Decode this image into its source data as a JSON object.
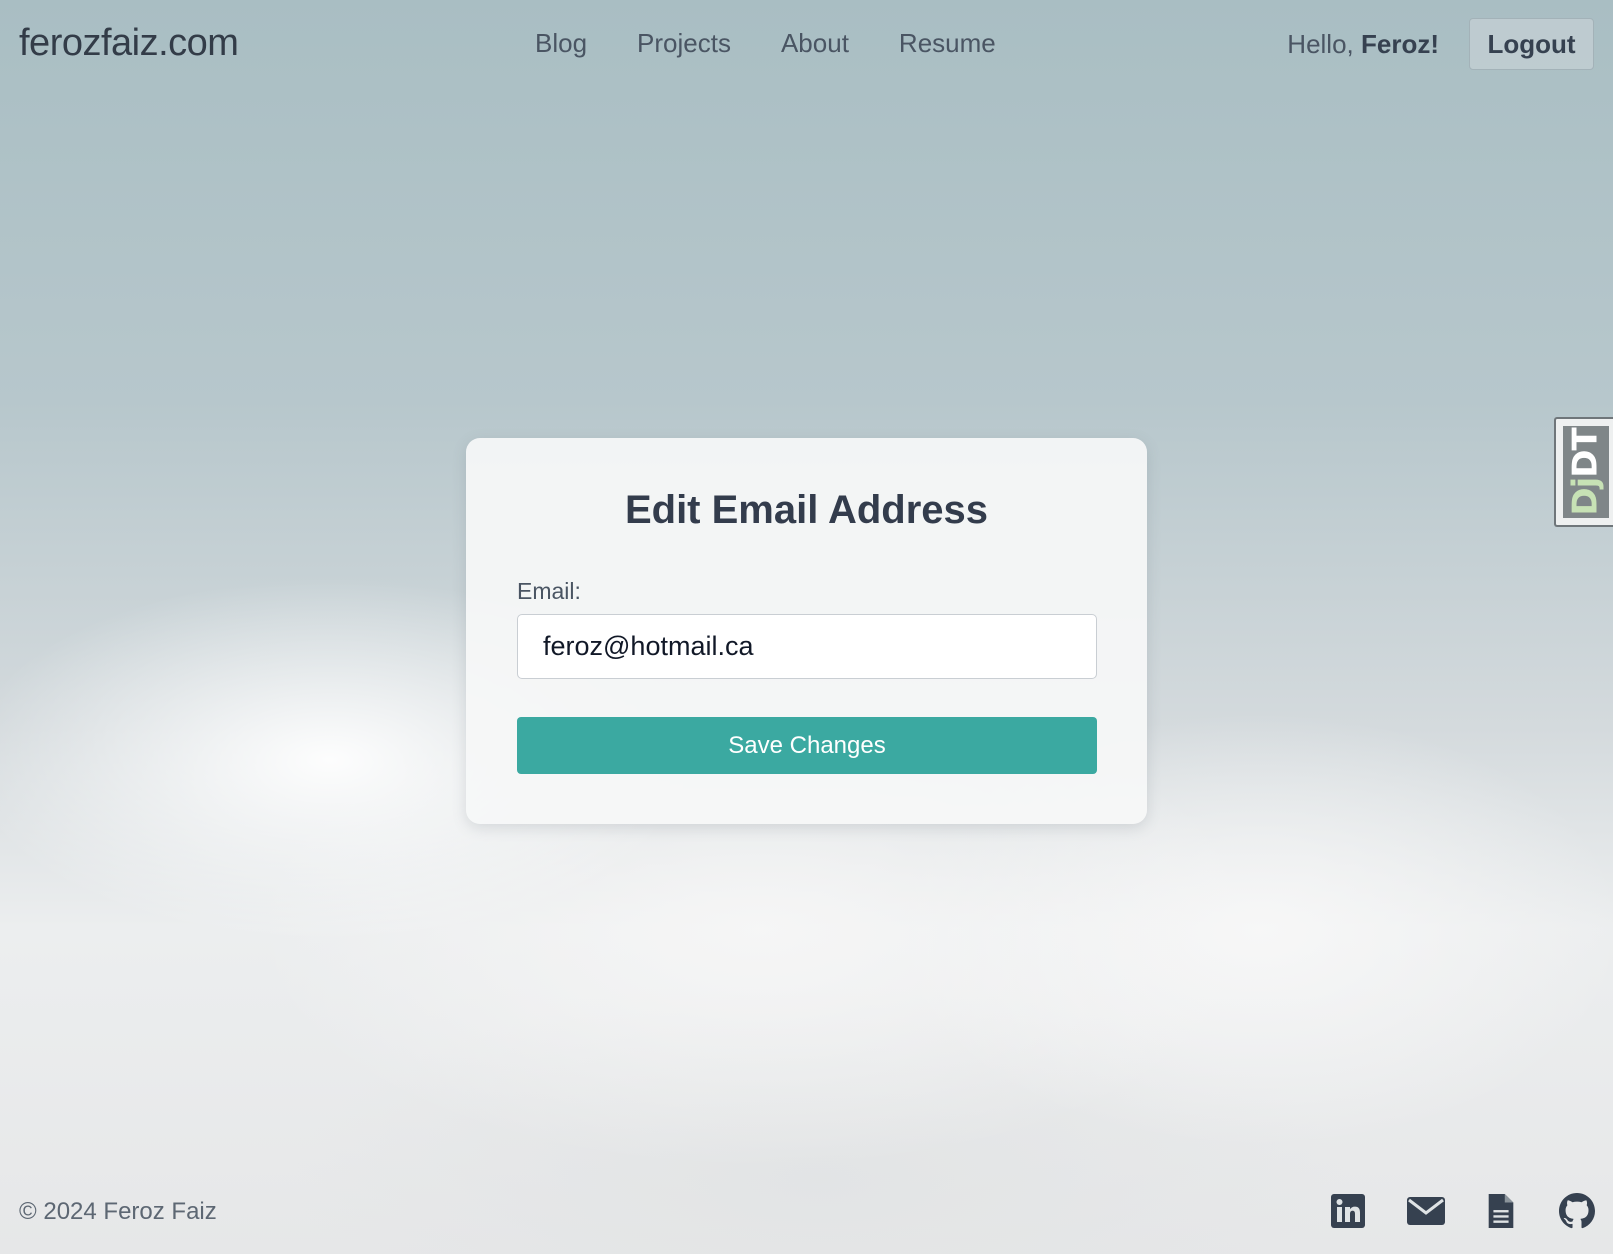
{
  "header": {
    "brand": "ferozfaiz.com",
    "nav": [
      {
        "label": "Blog"
      },
      {
        "label": "Projects"
      },
      {
        "label": "About"
      },
      {
        "label": "Resume"
      }
    ],
    "greeting_prefix": "Hello, ",
    "user_name": "Feroz!",
    "logout_label": "Logout"
  },
  "debug_toolbar": {
    "label_dj": "Dj",
    "label_dt": "DT"
  },
  "form": {
    "title": "Edit Email Address",
    "email_label": "Email:",
    "email_value": "feroz@hotmail.ca",
    "submit_label": "Save Changes"
  },
  "footer": {
    "copyright": "© 2024 Feroz Faiz",
    "icons": [
      "linkedin-icon",
      "email-icon",
      "document-icon",
      "github-icon"
    ]
  },
  "colors": {
    "accent": "#3ba9a1",
    "text_dark": "#333c4c",
    "icon": "#364150"
  }
}
